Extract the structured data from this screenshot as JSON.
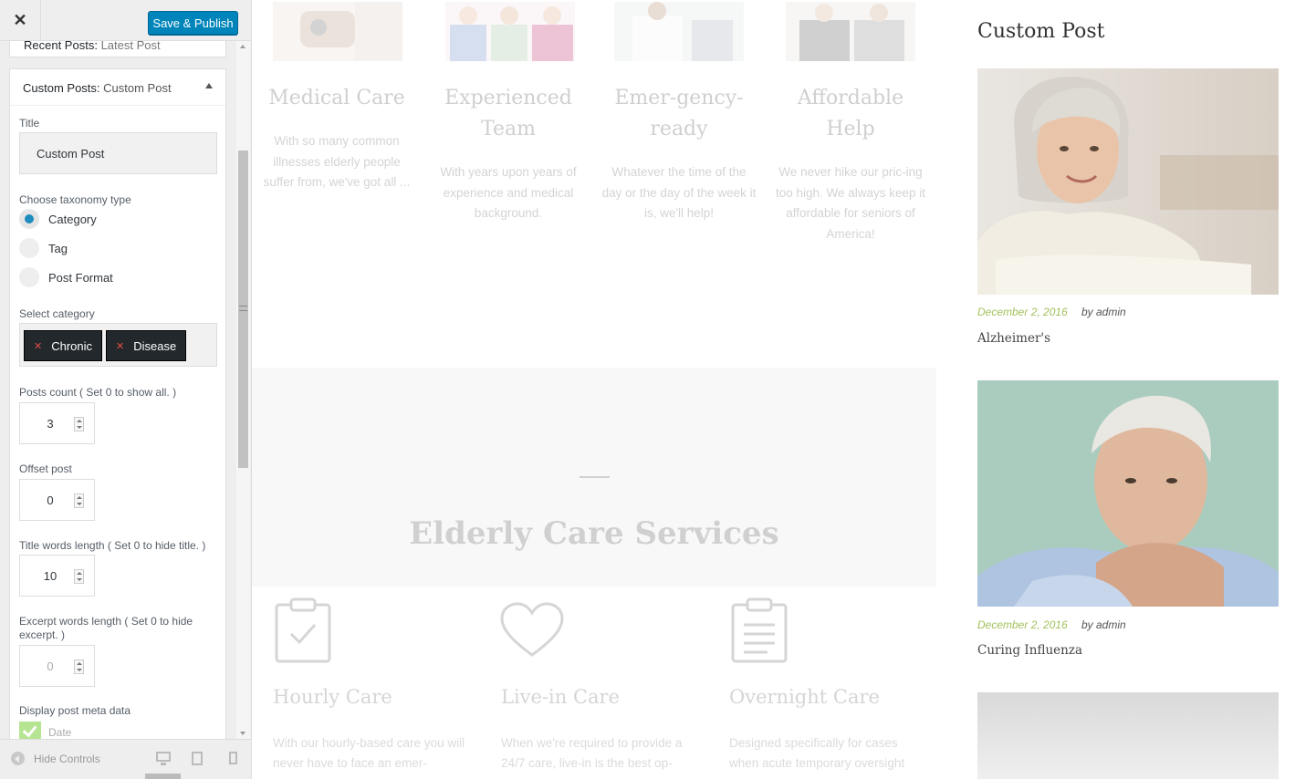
{
  "header": {
    "close_label": "✕",
    "publish_label": "Save & Publish"
  },
  "previous_widget": {
    "prefix": "Recent Posts:",
    "name": "Latest Post"
  },
  "widget": {
    "type_label": "Custom Posts:",
    "name": "Custom Post",
    "title_label": "Title",
    "title_value": "Custom Post",
    "taxonomy_label": "Choose taxonomy type",
    "taxonomy_options": [
      "Category",
      "Tag",
      "Post Format"
    ],
    "taxonomy_selected": "Category",
    "category_label": "Select category",
    "categories": [
      "Chronic",
      "Disease"
    ],
    "posts_count_label": "Posts count ( Set 0 to show all. )",
    "posts_count": "3",
    "offset_label": "Offset post",
    "offset": "0",
    "title_words_label": "Title words length ( Set 0 to hide title. )",
    "title_words": "10",
    "excerpt_words_label": "Excerpt words length ( Set 0 to hide excerpt. )",
    "excerpt_words": "0",
    "meta_label": "Display post meta data",
    "meta_option": "Date"
  },
  "footer": {
    "hide_controls_label": "Hide Controls"
  },
  "preview": {
    "features": [
      {
        "title": "Medical Care",
        "text": "With so many common illnesses elderly people suffer from, we've got all ..."
      },
      {
        "title": "Experienced Team",
        "text": "With years upon years of experience and medical background."
      },
      {
        "title": "Emer-gency-ready",
        "text": "Whatever the time of the day or the day of the week it is, we'll help!"
      },
      {
        "title": "Affordable Help",
        "text": "We never hike our pric-ing too high. We always keep it affordable for seniors of America!"
      }
    ],
    "services_title": "Elderly Care Services",
    "services": [
      {
        "name": "Hourly Care",
        "text": "With our hourly-based care you will never have to face an emer-"
      },
      {
        "name": "Live-in Care",
        "text": "When we're required to provide a 24/7 care, live-in is the best op-"
      },
      {
        "name": "Overnight Care",
        "text": "Designed specifically for cases when acute temporary oversight"
      }
    ],
    "sidebar_title": "Custom Post",
    "posts": [
      {
        "date": "December 2, 2016",
        "author": "by admin",
        "title": "Alzheimer's"
      },
      {
        "date": "December 2, 2016",
        "author": "by admin",
        "title": "Curing Influenza"
      }
    ]
  }
}
